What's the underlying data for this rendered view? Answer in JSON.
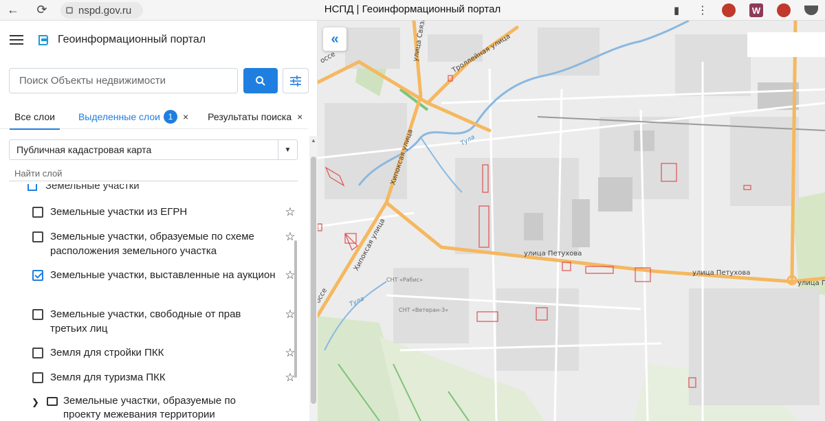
{
  "browser": {
    "url": "nspd.gov.ru",
    "title": "НСПД | Геоинформационный портал",
    "back_icon": "arrow-left-icon",
    "reload_icon": "reload-icon",
    "more_icon": "kebab-menu-icon",
    "extensions": [
      {
        "name": "ext-1",
        "color": "#c0392b"
      },
      {
        "name": "ext-w",
        "label": "W",
        "color": "#8e3a59"
      },
      {
        "name": "ext-2",
        "color": "#c0392b"
      }
    ]
  },
  "app": {
    "title": "Геоинформационный портал"
  },
  "search": {
    "placeholder": "Поиск Объекты недвижимости"
  },
  "tabs": {
    "all": "Все слои",
    "selected": "Выделенные слои",
    "selected_count": "1",
    "results": "Результаты поиска",
    "close": "×"
  },
  "layer_select": {
    "value": "Публичная кадастровая карта"
  },
  "find_layer": {
    "placeholder": "Найти слой"
  },
  "layers": {
    "cut_item": "Земельные участки",
    "items": [
      {
        "label": "Земельные участки из ЕГРН",
        "checked": false
      },
      {
        "label": "Земельные участки, образуемые по схеме расположения земельного участка",
        "checked": false
      },
      {
        "label": "Земельные участки, выставленные на аукцион",
        "checked": true
      },
      {
        "label": "Земельные участки, свободные от прав третьих лиц",
        "checked": false
      },
      {
        "label": "Земля для стройки ПКК",
        "checked": false
      },
      {
        "label": "Земля для туризма ПКК",
        "checked": false
      }
    ],
    "folder": "Земельные участки, образуемые по проекту межевания территории"
  },
  "map": {
    "streets": {
      "troll": "Троллейная улица",
      "svyazistov": "улица Связистов",
      "khipo1": "Хипоксая улица",
      "khipo2": "Хипоксая улица",
      "petukhova1": "улица Петухова",
      "petukhova2": "улица Петухова",
      "petukhova3": "улица Пе",
      "shosse1": "оссе",
      "shosse2": "оссе"
    },
    "rivers": {
      "tula1": "Тула",
      "tula2": "Тула"
    },
    "snt": {
      "rabis": "СНТ «Рабис»",
      "veteran": "СНТ «Ветеран-3»"
    },
    "colors": {
      "road": "#f5b860",
      "parcel": "#e05050",
      "river": "#8ab8e0",
      "green": "#cfe2bf"
    }
  }
}
